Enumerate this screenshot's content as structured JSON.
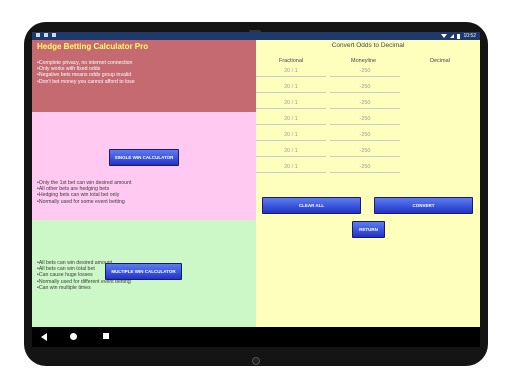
{
  "status": {
    "time": "10:52"
  },
  "app": {
    "title": "Hedge Betting Calculator Pro",
    "intro_bullets": [
      "Complete privacy, no internet connection",
      "Only works with fixed odds",
      "Negative bets means odds group invalid",
      "Don't bet money you cannot afford to lose"
    ],
    "single_button": "SINGLE WIN CALCULATOR",
    "single_bullets": [
      "Only the 1st bet can win desired amount",
      "All other bets are hedging bets",
      "Hedging bets can win total bet only",
      "Normally used for some event betting"
    ],
    "multi_button": "MULTIPLE WIN CALCULATOR",
    "multi_bullets": [
      "All bets can win desired amount",
      "All bets can win total bet",
      "Can cause huge losses",
      "Normally used for different event betting",
      "Can win multiple times"
    ]
  },
  "converter": {
    "title": "Convert Odds to Decimal",
    "col_fractional": "Fractional",
    "col_moneyline": "Moneyline",
    "col_decimal": "Decimal",
    "rows": [
      {
        "fractional": "20 / 1",
        "moneyline": "-250"
      },
      {
        "fractional": "20 / 1",
        "moneyline": "-250"
      },
      {
        "fractional": "20 / 1",
        "moneyline": "-250"
      },
      {
        "fractional": "20 / 1",
        "moneyline": "-250"
      },
      {
        "fractional": "20 / 1",
        "moneyline": "-250"
      },
      {
        "fractional": "20 / 1",
        "moneyline": "-250"
      },
      {
        "fractional": "20 / 1",
        "moneyline": "-250"
      }
    ],
    "clear_label": "CLEAR ALL",
    "convert_label": "CONVERT",
    "return_label": "RETURN"
  }
}
